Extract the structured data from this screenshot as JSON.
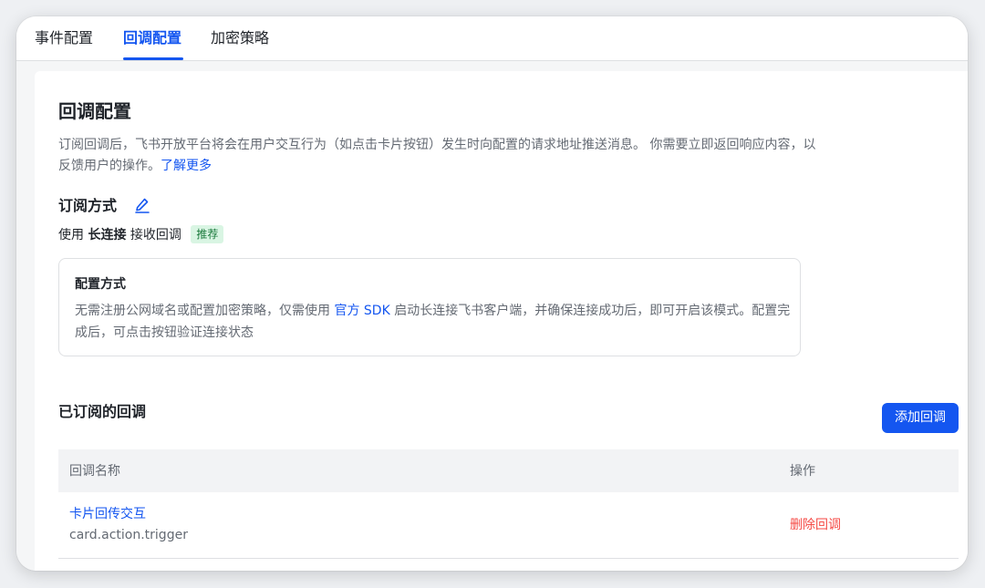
{
  "tabs": [
    {
      "label": "事件配置"
    },
    {
      "label": "回调配置"
    },
    {
      "label": "加密策略"
    }
  ],
  "active_tab": "回调配置",
  "page": {
    "title": "回调配置",
    "description": "订阅回调后，飞书开放平台将会在用户交互行为（如点击卡片按钮）发生时向配置的请求地址推送消息。 你需要立即返回响应内容，以反馈用户的操作。",
    "learn_more": "了解更多"
  },
  "subscription": {
    "title": "订阅方式",
    "edit_icon": "edit-pencil-icon",
    "prefix": "使用",
    "mode": "长连接",
    "suffix": "接收回调",
    "badge": "推荐"
  },
  "config_box": {
    "title": "配置方式",
    "text_before": "无需注册公网域名或配置加密策略，仅需使用",
    "sdk_link": "官方 SDK",
    "text_after": "启动长连接飞书客户端，并确保连接成功后，即可开启该模式。配置完成后，可点击按钮验证连接状态"
  },
  "subscribed": {
    "title": "已订阅的回调",
    "add_button": "添加回调",
    "columns": {
      "name": "回调名称",
      "action": "操作"
    },
    "rows": [
      {
        "name": "卡片回传交互",
        "key": "card.action.trigger",
        "action": "删除回调"
      }
    ]
  },
  "colors": {
    "accent": "#1456f0",
    "danger": "#f54a45",
    "badge_bg": "#d9f5e3",
    "badge_text": "#1b7a3c"
  }
}
